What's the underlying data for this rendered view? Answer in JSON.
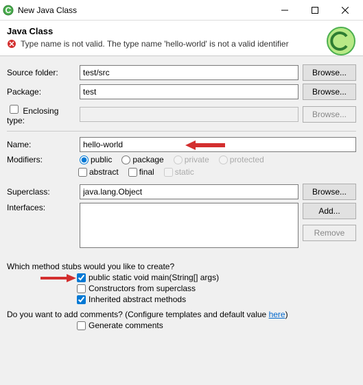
{
  "window": {
    "title": "New Java Class"
  },
  "header": {
    "title": "Java Class",
    "error": "Type name is not valid. The type name 'hello-world' is not a valid identifier"
  },
  "labels": {
    "sourceFolder": "Source folder:",
    "package": "Package:",
    "enclosingType": "Enclosing type:",
    "name": "Name:",
    "modifiers": "Modifiers:",
    "superclass": "Superclass:",
    "interfaces": "Interfaces:"
  },
  "fields": {
    "sourceFolder": "test/src",
    "package": "test",
    "enclosingType": "",
    "name": "hello-world",
    "superclass": "java.lang.Object"
  },
  "buttons": {
    "browse": "Browse...",
    "add": "Add...",
    "remove": "Remove"
  },
  "modifiers": {
    "public": "public",
    "packageM": "package",
    "private": "private",
    "protected": "protected",
    "abstract": "abstract",
    "final": "final",
    "static": "static"
  },
  "stubs": {
    "question": "Which method stubs would you like to create?",
    "main": "public static void main(String[] args)",
    "constructors": "Constructors from superclass",
    "inherited": "Inherited abstract methods"
  },
  "comments": {
    "questionPrefix": "Do you want to add comments? (Configure templates and default value ",
    "linkText": "here",
    "questionSuffix": ")",
    "generate": "Generate comments"
  }
}
